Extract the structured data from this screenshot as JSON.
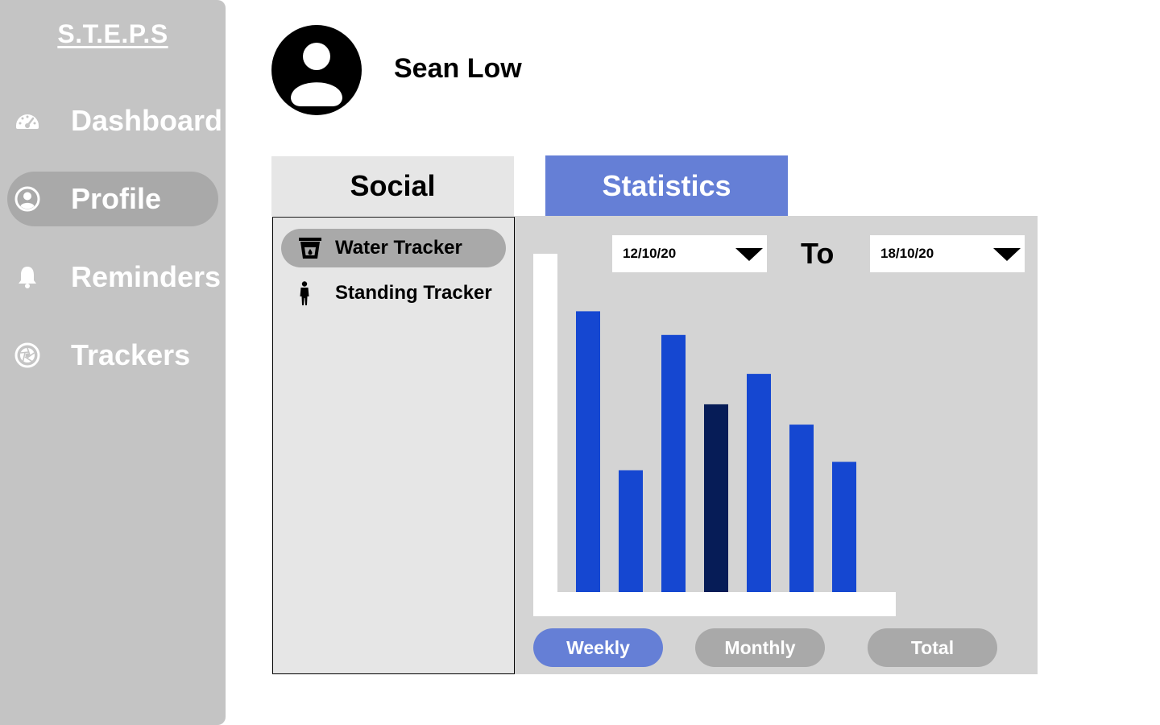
{
  "app": {
    "brand": "S.T.E.P.S"
  },
  "sidebar": {
    "items": [
      {
        "label": "Dashboard",
        "icon": "speedometer-icon",
        "active": false
      },
      {
        "label": "Profile",
        "icon": "user-circle-icon",
        "active": true
      },
      {
        "label": "Reminders",
        "icon": "bell-icon",
        "active": false
      },
      {
        "label": "Trackers",
        "icon": "aperture-icon",
        "active": false
      }
    ]
  },
  "profile": {
    "name": "Sean Low",
    "avatar_icon": "user-avatar-icon"
  },
  "tabs": [
    {
      "label": "Social",
      "active": false
    },
    {
      "label": "Statistics",
      "active": true
    }
  ],
  "trackers": [
    {
      "label": "Water Tracker",
      "icon": "water-glass-icon",
      "active": true
    },
    {
      "label": "Standing Tracker",
      "icon": "standing-person-icon",
      "active": false
    }
  ],
  "date_range": {
    "from": "12/10/20",
    "to_label": "To",
    "to": "18/10/20"
  },
  "chart_data": {
    "type": "bar",
    "categories": [
      "",
      "",
      "",
      "",
      "",
      "",
      ""
    ],
    "values": [
      0.83,
      0.36,
      0.76,
      0.555,
      0.645,
      0.495,
      0.385
    ],
    "highlight_index": 3,
    "ylim": [
      0,
      1
    ],
    "title": "",
    "xlabel": "",
    "ylabel": "",
    "grid": false,
    "colors": {
      "bar": "#1547d1",
      "highlight": "#061c57",
      "axis": "#ffffff"
    }
  },
  "periods": [
    {
      "label": "Weekly",
      "active": true
    },
    {
      "label": "Monthly",
      "active": false
    },
    {
      "label": "Total",
      "active": false
    }
  ],
  "colors": {
    "sidebar": "#c4c4c4",
    "active_pill": "#a9a9a9",
    "accent": "#657fd6",
    "panel": "#e6e6e6",
    "stats_bg": "#d4d4d4"
  }
}
